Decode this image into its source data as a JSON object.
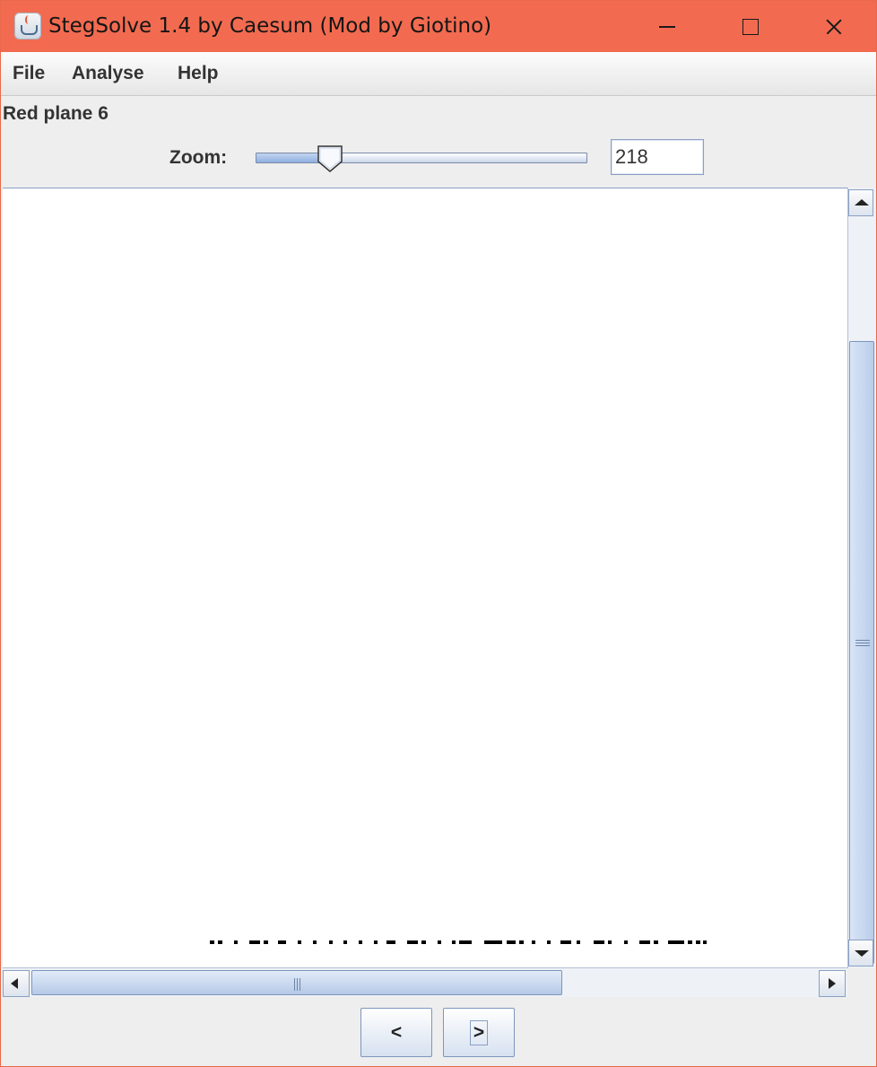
{
  "window": {
    "title": "StegSolve 1.4 by Caesum (Mod by Giotino)",
    "title_bar_color": "#f26b50",
    "app_icon": "java-cup-icon",
    "controls": [
      "minimize-icon",
      "maximize-icon",
      "close-icon"
    ]
  },
  "menu": {
    "items": [
      "File",
      "Analyse",
      "Help"
    ]
  },
  "plane_label": "Red plane 6",
  "zoom": {
    "label": "Zoom:",
    "value": "218",
    "slider_fraction": 0.2
  },
  "nav": {
    "prev_label": "<",
    "next_label": ">"
  }
}
